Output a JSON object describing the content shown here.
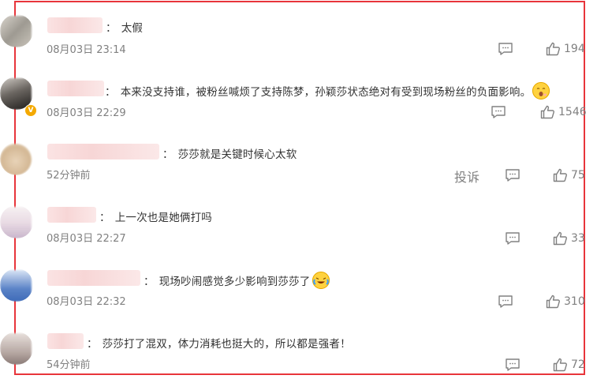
{
  "comments": [
    {
      "text": "太假",
      "time": "08月03日 23:14",
      "likes": "194",
      "emoji": ""
    },
    {
      "text": "本来没支持谁，被粉丝喊烦了支持陈梦，孙颖莎状态绝对有受到现场粉丝的负面影响。",
      "time": "08月03日 22:29",
      "likes": "1546",
      "emoji": "yawn-emoji-icon"
    },
    {
      "text": "莎莎就是关键时候心太软",
      "time": "52分钟前",
      "likes": "75",
      "emoji": "",
      "report": "投诉"
    },
    {
      "text": "上一次也是她俩打吗",
      "time": "08月03日 22:27",
      "likes": "33",
      "emoji": ""
    },
    {
      "text": "现场吵闹感觉多少影响到莎莎了",
      "time": "08月03日 22:32",
      "likes": "310",
      "emoji": "crying-laugh-emoji-icon"
    },
    {
      "text": "莎莎打了混双，体力消耗也挺大的，所以都是强者！",
      "time": "54分钟前",
      "likes": "72",
      "emoji": ""
    }
  ],
  "colors": {
    "frame": "#e8353b",
    "meta": "#808080",
    "text": "#333333",
    "verified": "#f4a900"
  }
}
